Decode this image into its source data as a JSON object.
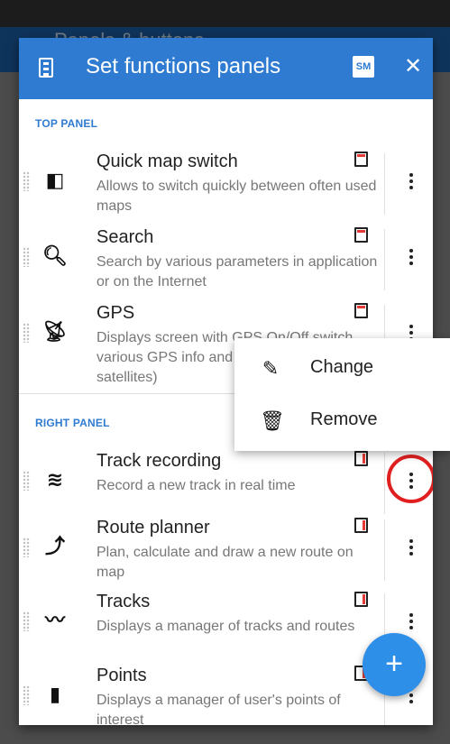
{
  "background": {
    "toolbar_title": "Panels & buttons"
  },
  "dialog": {
    "title": "Set functions panels",
    "sm_label": "SM",
    "close_glyph": "✕",
    "sections": [
      {
        "label": "TOP PANEL"
      },
      {
        "label": "RIGHT PANEL"
      }
    ],
    "top_items": [
      {
        "name": "Quick map switch",
        "desc": "Allows to switch quickly between often used maps",
        "icon": "map-switch-icon",
        "glyph": "◧"
      },
      {
        "name": "Search",
        "desc": "Search by various parameters in application or on the Internet",
        "icon": "search-icon",
        "glyph": "🔍︎"
      },
      {
        "name": "GPS",
        "desc": "Displays screen with GPS On/Off switch, various GPS info and skyplot (overview of satellites)",
        "icon": "gps-icon",
        "glyph": "📡︎"
      }
    ],
    "right_items": [
      {
        "name": "Track recording",
        "desc": "Record a new track in real time",
        "icon": "track-recording-icon",
        "glyph": "≋"
      },
      {
        "name": "Route planner",
        "desc": "Plan, calculate and draw a new route on map",
        "icon": "route-planner-icon",
        "glyph": "⤴"
      },
      {
        "name": "Tracks",
        "desc": "Displays a manager of tracks and routes",
        "icon": "tracks-icon",
        "glyph": "〰"
      },
      {
        "name": "Points",
        "desc": "Displays a manager of user's points of interest",
        "icon": "points-icon",
        "glyph": "▮"
      }
    ]
  },
  "popup_menu": {
    "items": [
      {
        "label": "Change",
        "icon": "pencil-icon",
        "glyph": "✎"
      },
      {
        "label": "Remove",
        "icon": "trash-icon",
        "glyph": "🗑︎"
      }
    ]
  },
  "fab": {
    "glyph": "+"
  },
  "colors": {
    "header": "#2e7bd1",
    "accent": "#2e7bd1",
    "fab": "#2e8fe8",
    "highlight": "#e02020"
  }
}
